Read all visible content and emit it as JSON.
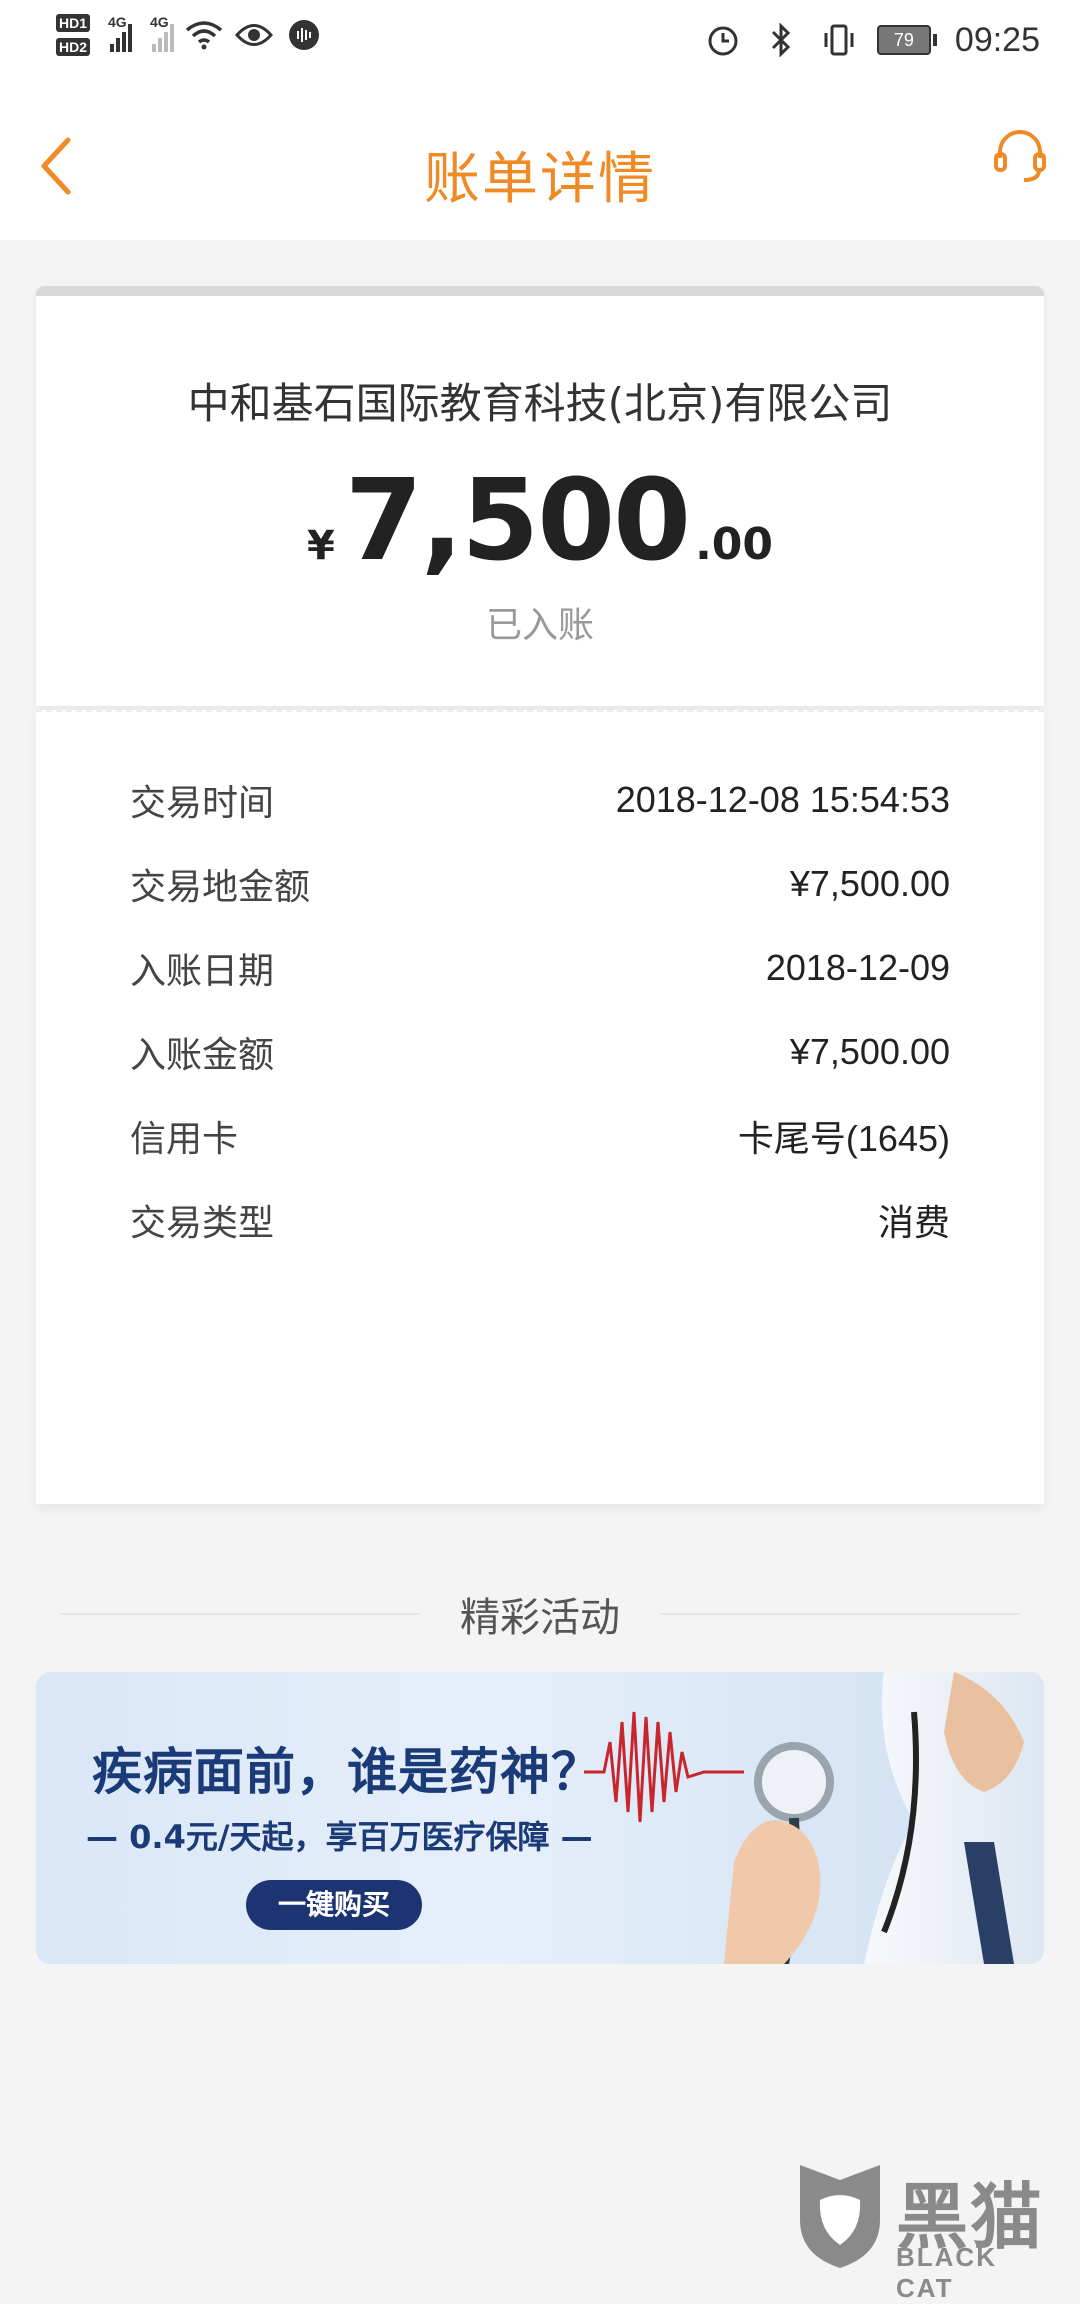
{
  "status_bar": {
    "hd1": "HD1",
    "hd2": "HD2",
    "net1": "4G",
    "net2": "4G",
    "battery": "79",
    "time": "09:25",
    "icons": [
      "signal-icon",
      "wifi-icon",
      "eye-icon",
      "voice-icon",
      "alarm-icon",
      "bluetooth-icon",
      "vibrate-icon",
      "battery-icon"
    ]
  },
  "header": {
    "title": "账单详情",
    "accent_color": "#f08a24"
  },
  "summary": {
    "merchant": "中和基石国际教育科技(北京)有限公司",
    "currency": "¥",
    "amount_main": "7,500",
    "amount_decimal": ".00",
    "status": "已入账"
  },
  "details": [
    {
      "label": "交易时间",
      "value": "2018-12-08 15:54:53"
    },
    {
      "label": "交易地金额",
      "value": "¥7,500.00"
    },
    {
      "label": "入账日期",
      "value": "2018-12-09"
    },
    {
      "label": "入账金额",
      "value": "¥7,500.00"
    },
    {
      "label": "信用卡",
      "value": "卡尾号(1645)"
    },
    {
      "label": "交易类型",
      "value": "消费"
    }
  ],
  "section": {
    "title": "精彩活动"
  },
  "banner": {
    "headline": "疾病面前，谁是药神？",
    "subline": "— 0.4元/天起，享百万医疗保障 —",
    "button": "一键购买"
  },
  "watermark": {
    "cn": "黑猫",
    "en": "BLACK CAT"
  }
}
